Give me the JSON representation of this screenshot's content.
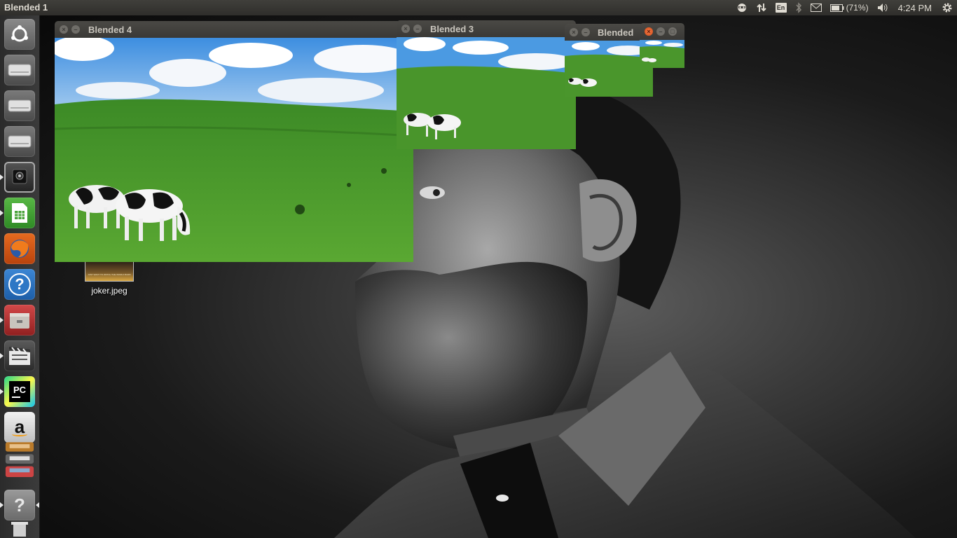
{
  "top_panel": {
    "active_app_title": "Blended  1",
    "battery_text": "(71%)",
    "keyboard_layout": "En",
    "clock": "4:24 PM",
    "indicators": [
      "session-indicator-icon",
      "network-icon",
      "keyboard-layout-icon",
      "bluetooth-icon",
      "mail-icon",
      "battery-icon",
      "volume-icon",
      "system-gear-icon"
    ]
  },
  "windows": [
    {
      "title": "Blended  4"
    },
    {
      "title": "Blended  3"
    },
    {
      "title": "Blended"
    },
    {
      "title": ""
    }
  ],
  "desktop": {
    "icon_label": "joker.jpeg",
    "thumbnail_caption": "JUST WANT TO WATCH THE WORLD BURN"
  },
  "launcher": {
    "items": [
      "ubuntu-dash-icon",
      "drive-icon",
      "drive-icon",
      "drive-icon",
      "webcam-icon",
      "libreoffice-calc-icon",
      "firefox-icon",
      "help-icon",
      "file-manager-icon",
      "video-editor-icon",
      "pycharm-icon",
      "amazon-icon",
      "workspace-switcher-icon",
      "help-icon",
      "trash-icon"
    ],
    "pycharm_text": "PC",
    "amazon_text": "a",
    "help_text": "?"
  },
  "colors": {
    "panel": "#3a3936",
    "launcher": "#333333",
    "close_active": "#e0541c",
    "grass": "#4a9a2a",
    "sky": "#4aa0e0"
  }
}
